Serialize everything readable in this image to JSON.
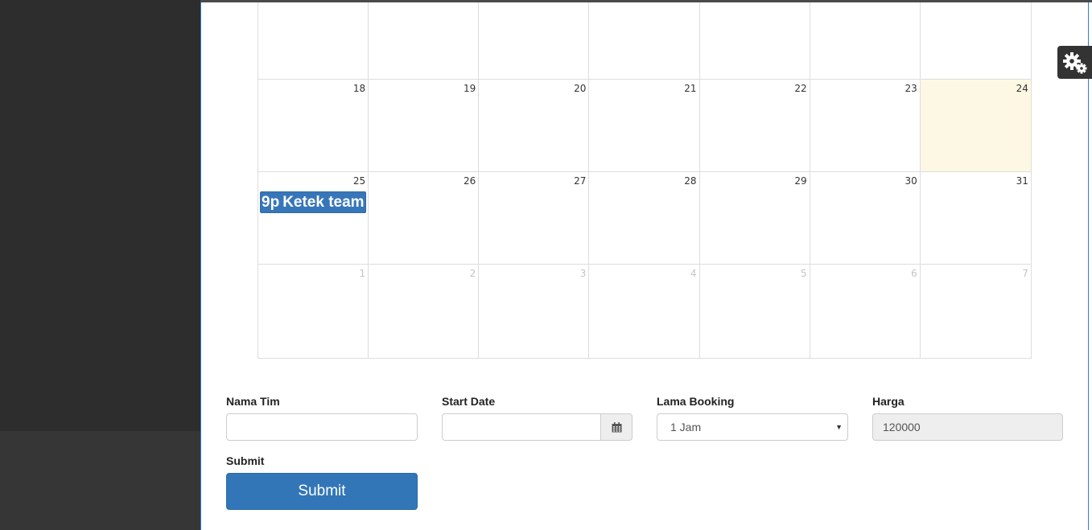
{
  "calendar": {
    "weeks": [
      {
        "days": [
          {
            "num": "",
            "other": false,
            "today": false
          },
          {
            "num": "",
            "other": false,
            "today": false
          },
          {
            "num": "",
            "other": false,
            "today": false
          },
          {
            "num": "",
            "other": false,
            "today": false
          },
          {
            "num": "",
            "other": false,
            "today": false
          },
          {
            "num": "",
            "other": false,
            "today": false
          },
          {
            "num": "",
            "other": false,
            "today": false
          }
        ]
      },
      {
        "days": [
          {
            "num": "18",
            "other": false,
            "today": false
          },
          {
            "num": "19",
            "other": false,
            "today": false
          },
          {
            "num": "20",
            "other": false,
            "today": false
          },
          {
            "num": "21",
            "other": false,
            "today": false
          },
          {
            "num": "22",
            "other": false,
            "today": false
          },
          {
            "num": "23",
            "other": false,
            "today": false
          },
          {
            "num": "24",
            "other": false,
            "today": true
          }
        ]
      },
      {
        "days": [
          {
            "num": "25",
            "other": false,
            "today": false
          },
          {
            "num": "26",
            "other": false,
            "today": false
          },
          {
            "num": "27",
            "other": false,
            "today": false
          },
          {
            "num": "28",
            "other": false,
            "today": false
          },
          {
            "num": "29",
            "other": false,
            "today": false
          },
          {
            "num": "30",
            "other": false,
            "today": false
          },
          {
            "num": "31",
            "other": false,
            "today": false
          }
        ]
      },
      {
        "days": [
          {
            "num": "1",
            "other": true,
            "today": false
          },
          {
            "num": "2",
            "other": true,
            "today": false
          },
          {
            "num": "3",
            "other": true,
            "today": false
          },
          {
            "num": "4",
            "other": true,
            "today": false
          },
          {
            "num": "5",
            "other": true,
            "today": false
          },
          {
            "num": "6",
            "other": true,
            "today": false
          },
          {
            "num": "7",
            "other": true,
            "today": false
          }
        ]
      }
    ],
    "event": {
      "time": "9p",
      "title": "Ketek team",
      "color": "#3776b8"
    },
    "today_color": "#fcf8e3"
  },
  "settings": {
    "icon": "gears-icon"
  },
  "form": {
    "nama_tim_label": "Nama Tim",
    "nama_tim_value": "",
    "start_date_label": "Start Date",
    "start_date_value": "",
    "calendar_icon": "calendar-icon",
    "lama_booking_label": "Lama Booking",
    "lama_booking_value": "1 Jam",
    "harga_label": "Harga",
    "harga_value": "120000",
    "submit_label": "Submit",
    "submit_button": "Submit",
    "accent_color": "#3276b8"
  }
}
